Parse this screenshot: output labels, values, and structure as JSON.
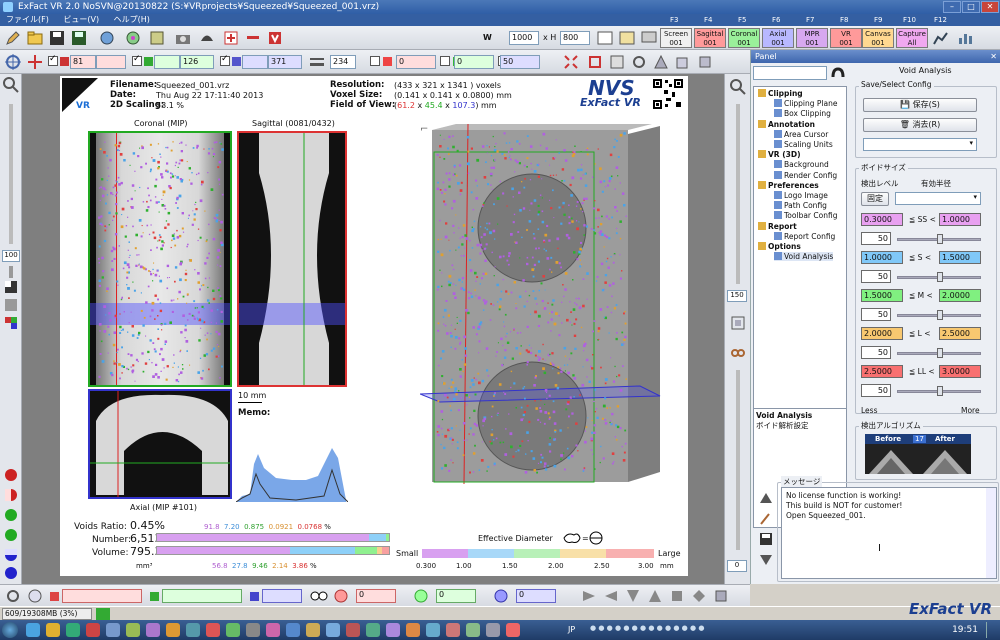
{
  "window": {
    "title": "ExFact VR 2.0 NoSVN@20130822 (S:¥VRprojects¥Squeezed¥Squeezed_001.vrz)"
  },
  "menu": [
    "ファイル(F)",
    "ビュー(V)",
    "ヘルプ(H)"
  ],
  "fkeys": [
    "F3",
    "F4",
    "F5",
    "F6",
    "F7",
    "F8",
    "F9",
    "F10",
    "F12"
  ],
  "toolbar": {
    "w_label": "W",
    "w_value": "1000",
    "xh_label": "x H",
    "h_value": "800",
    "view_buttons": [
      {
        "line1": "Screen",
        "line2": "001",
        "color": "#f0f0f0"
      },
      {
        "line1": "Sagittal",
        "line2": "001",
        "color": "#ff9a9a"
      },
      {
        "line1": "Coronal",
        "line2": "001",
        "color": "#9af09a"
      },
      {
        "line1": "Axial",
        "line2": "001",
        "color": "#b8b8ff"
      },
      {
        "line1": "MPR",
        "line2": "001",
        "color": "#d7a8f0"
      },
      {
        "line1": "VR",
        "line2": "001",
        "color": "#ff9a9a"
      },
      {
        "line1": "Canvas",
        "line2": "001",
        "color": "#ffd890"
      },
      {
        "line1": "Capture",
        "line2": "All",
        "color": "#f0a8f0"
      }
    ]
  },
  "toolbar2": {
    "slice_sagittal": "81",
    "slice_coronal": "126",
    "slice_axial": "371",
    "thickness": "234",
    "r_value": "0",
    "g_value": "0",
    "b_value": "50"
  },
  "report": {
    "filename_label": "Filename:",
    "filename": "Squeezed_001.vrz",
    "date_label": "Date:",
    "date": "Thu Aug 22 17:11:40 2013",
    "scaling_label": "2D Scaling:",
    "scaling": "53.1 %",
    "resolution_label": "Resolution:",
    "resolution": "(433 x 321 x 1341 ) voxels",
    "voxel_label": "Voxel Size:",
    "voxel": "(0.141 x 0.141 x 0.0800) mm",
    "fov_label": "Field of View:",
    "fov_x": "61.2",
    "fov_y": "45.4",
    "fov_z": "107.3",
    "fov_unit": "mm",
    "logo_text": "NVS",
    "logo_sub": "ExFact VR",
    "coronal_title": "Coronal (MIP)",
    "sagittal_title": "Sagittal (0081/0432)",
    "axial_title": "Axial (MIP #101)",
    "scale_label": "10 mm",
    "memo_label": "Memo:",
    "voids_ratio_label": "Voids Ratio:",
    "voids_ratio": "0.45%",
    "ratio_parts": [
      "91.8",
      "7.20",
      "0.875",
      "0.0921",
      "0.0768"
    ],
    "ratio_unit": "%",
    "ratio_colors": [
      "#c07ae0",
      "#6fb4f0",
      "#6ad46a",
      "#e8a850",
      "#e85a5a"
    ],
    "number_label": "Number:",
    "number": "6,513",
    "volume_label": "Volume:",
    "volume": "795.3",
    "volume_unit": "mm³",
    "volume_parts": [
      "56.8",
      "27.8",
      "9.46",
      "2.14",
      "3.86"
    ],
    "effective_diameter": "Effective Diameter",
    "small": "Small",
    "large": "Large",
    "scale_ticks": [
      "0.300",
      "1.00",
      "1.50",
      "2.00",
      "2.50",
      "3.00"
    ],
    "scale_unit": "mm"
  },
  "panel": {
    "title": "Panel",
    "tab": "Void Analysis",
    "tree": [
      {
        "label": "Clipping",
        "bold": true,
        "level": 0
      },
      {
        "label": "Clipping Plane",
        "bold": false,
        "level": 1
      },
      {
        "label": "Box Clipping",
        "bold": false,
        "level": 1
      },
      {
        "label": "Annotation",
        "bold": true,
        "level": 0
      },
      {
        "label": "Area Cursor",
        "bold": false,
        "level": 1
      },
      {
        "label": "Scaling Units",
        "bold": false,
        "level": 1
      },
      {
        "label": "VR (3D)",
        "bold": true,
        "level": 0
      },
      {
        "label": "Background",
        "bold": false,
        "level": 1
      },
      {
        "label": "Render Config",
        "bold": false,
        "level": 1
      },
      {
        "label": "Preferences",
        "bold": true,
        "level": 0
      },
      {
        "label": "Logo Image",
        "bold": false,
        "level": 1
      },
      {
        "label": "Path Config",
        "bold": false,
        "level": 1
      },
      {
        "label": "Toolbar Config",
        "bold": false,
        "level": 1
      },
      {
        "label": "Report",
        "bold": true,
        "level": 0
      },
      {
        "label": "Report Config",
        "bold": false,
        "level": 1
      },
      {
        "label": "Options",
        "bold": true,
        "level": 0
      },
      {
        "label": "Void Analysis",
        "bold": false,
        "level": 1
      }
    ],
    "desc_title": "Void Analysis",
    "desc_text": "ボイド解析設定",
    "save_select": "Save/Select Config",
    "save_btn": "保存(S)",
    "delete_btn": "消去(R)",
    "void_size": "ボイドサイズ",
    "detect_level": "検出レベル",
    "effective_radius": "有効半径",
    "fixed_btn": "固定",
    "rows": [
      {
        "lo": "0.3000",
        "op": "≦ SS <",
        "hi": "1.0000",
        "color": "#e8a0f0",
        "level": "50"
      },
      {
        "lo": "1.0000",
        "op": "≦ S <",
        "hi": "1.5000",
        "color": "#80c8f8",
        "level": "50"
      },
      {
        "lo": "1.5000",
        "op": "≦ M <",
        "hi": "2.0000",
        "color": "#80f080",
        "level": "50"
      },
      {
        "lo": "2.0000",
        "op": "≦ L <",
        "hi": "2.5000",
        "color": "#f8c870",
        "level": "50"
      },
      {
        "lo": "2.5000",
        "op": "≦ LL <",
        "hi": "3.0000",
        "color": "#f87070",
        "level": "50"
      }
    ],
    "less": "Less",
    "more": "More",
    "algo_title": "検出アルゴリズム",
    "before": "Before",
    "after": "After",
    "algo_num": "17",
    "message_title": "メッセージ",
    "messages": [
      "No license function is working!",
      "This build is NOT for customer!",
      "Open Squeezed_001."
    ]
  },
  "side": {
    "zoom_left": "100",
    "zoom_right": "150",
    "count_right": "0"
  },
  "status": {
    "memory": "609/19308MB (3%)"
  },
  "brand": "ExFact VR",
  "taskbar": {
    "lang": "JP",
    "time": "19:51"
  }
}
